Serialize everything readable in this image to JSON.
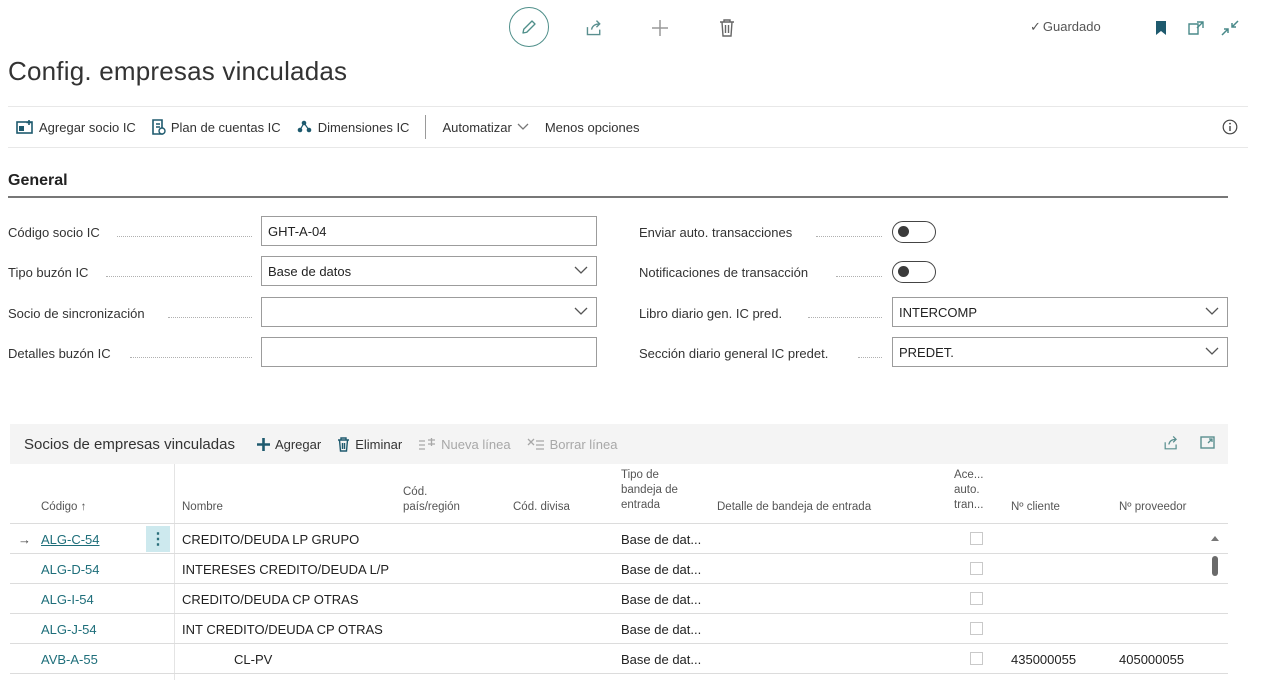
{
  "header": {
    "saved_label": "Guardado",
    "page_title": "Config. empresas vinculadas"
  },
  "actions": [
    {
      "label": "Agregar socio IC"
    },
    {
      "label": "Plan de cuentas IC"
    },
    {
      "label": "Dimensiones IC"
    },
    {
      "label": "Automatizar"
    },
    {
      "label": "Menos opciones"
    }
  ],
  "general": {
    "title": "General",
    "fields": {
      "codigo_socio_label": "Código socio IC",
      "codigo_socio_value": "GHT-A-04",
      "tipo_buzon_label": "Tipo buzón IC",
      "tipo_buzon_value": "Base de datos",
      "socio_sync_label": "Socio de sincronización",
      "socio_sync_value": "",
      "detalles_buzon_label": "Detalles buzón IC",
      "detalles_buzon_value": "",
      "enviar_auto_label": "Enviar auto. transacciones",
      "notif_label": "Notificaciones de transacción",
      "libro_label": "Libro diario gen. IC pred.",
      "libro_value": "INTERCOMP",
      "seccion_label": "Sección diario general IC predet.",
      "seccion_value": "PREDET."
    },
    "enviar_auto_on": false,
    "notif_on": false
  },
  "subpage": {
    "title": "Socios de empresas vinculadas",
    "actions": {
      "agregar": "Agregar",
      "eliminar": "Eliminar",
      "nueva_linea": "Nueva línea",
      "borrar_linea": "Borrar línea"
    },
    "columns": {
      "codigo": "Código ↑",
      "nombre": "Nombre",
      "pais_1": "Cód.",
      "pais_2": "país/región",
      "divisa": "Cód. divisa",
      "tipo_1": "Tipo de",
      "tipo_2": "bandeja de",
      "tipo_3": "entrada",
      "detalle": "Detalle de bandeja de entrada",
      "acep_1": "Ace...",
      "acep_2": "auto.",
      "acep_3": "tran...",
      "cliente": "Nº cliente",
      "proveedor": "Nº proveedor"
    },
    "rows": [
      {
        "code": "ALG-C-54",
        "name": "CREDITO/DEUDA LP GRUPO",
        "tipo": "Base de dat...",
        "cliente": "",
        "proveedor": ""
      },
      {
        "code": "ALG-D-54",
        "name": "INTERESES CREDITO/DEUDA L/P",
        "tipo": "Base de dat...",
        "cliente": "",
        "proveedor": ""
      },
      {
        "code": "ALG-I-54",
        "name": "CREDITO/DEUDA CP OTRAS",
        "tipo": "Base de dat...",
        "cliente": "",
        "proveedor": ""
      },
      {
        "code": "ALG-J-54",
        "name": "INT CREDITO/DEUDA CP OTRAS",
        "tipo": "Base de dat...",
        "cliente": "",
        "proveedor": ""
      },
      {
        "code": "AVB-A-55",
        "name": "CL-PV",
        "tipo": "Base de dat...",
        "cliente": "435000055",
        "proveedor": "405000055"
      }
    ]
  },
  "colors": {
    "accent": "#1e6e7a",
    "edit_ring": "#4f8f8a",
    "row_selected_menu": "#cde9ee"
  },
  "icons": [
    "edit-icon",
    "share-icon",
    "add-icon",
    "delete-icon",
    "bookmark-icon",
    "open-new-window-icon",
    "collapse-icon",
    "info-icon"
  ]
}
